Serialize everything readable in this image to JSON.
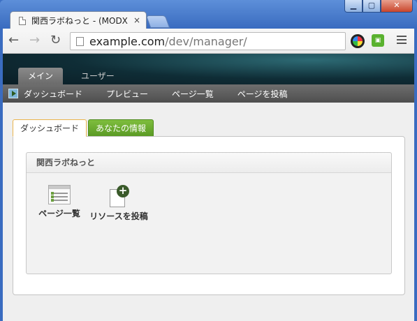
{
  "window": {
    "minimize_icon": "minimize-icon",
    "maximize_icon": "maximize-icon",
    "close_icon": "close-icon"
  },
  "browser": {
    "tab_title": "関西ラボねっと - (MODX",
    "tab_close": "×",
    "url_host": "example.com",
    "url_path": "/dev/manager/"
  },
  "manager": {
    "top_tabs": [
      {
        "label": "メイン",
        "active": true
      },
      {
        "label": "ユーザー",
        "active": false
      }
    ],
    "nav_links": [
      "ダッシュボード",
      "プレビュー",
      "ページ一覧",
      "ページを投稿"
    ]
  },
  "content": {
    "tabs": [
      {
        "label": "ダッシュボード",
        "active": true
      },
      {
        "label": "あなたの情報",
        "active": false
      }
    ],
    "panel_title": "関西ラボねっと",
    "shortcuts": [
      {
        "label": "ページ一覧",
        "icon": "page-list-icon"
      },
      {
        "label": "リソースを投稿",
        "icon": "add-resource-icon"
      }
    ]
  },
  "colors": {
    "active_content_tab_border": "#e9b44c",
    "info_tab": "#6aa92e",
    "header_dark": "#0f2d36"
  }
}
